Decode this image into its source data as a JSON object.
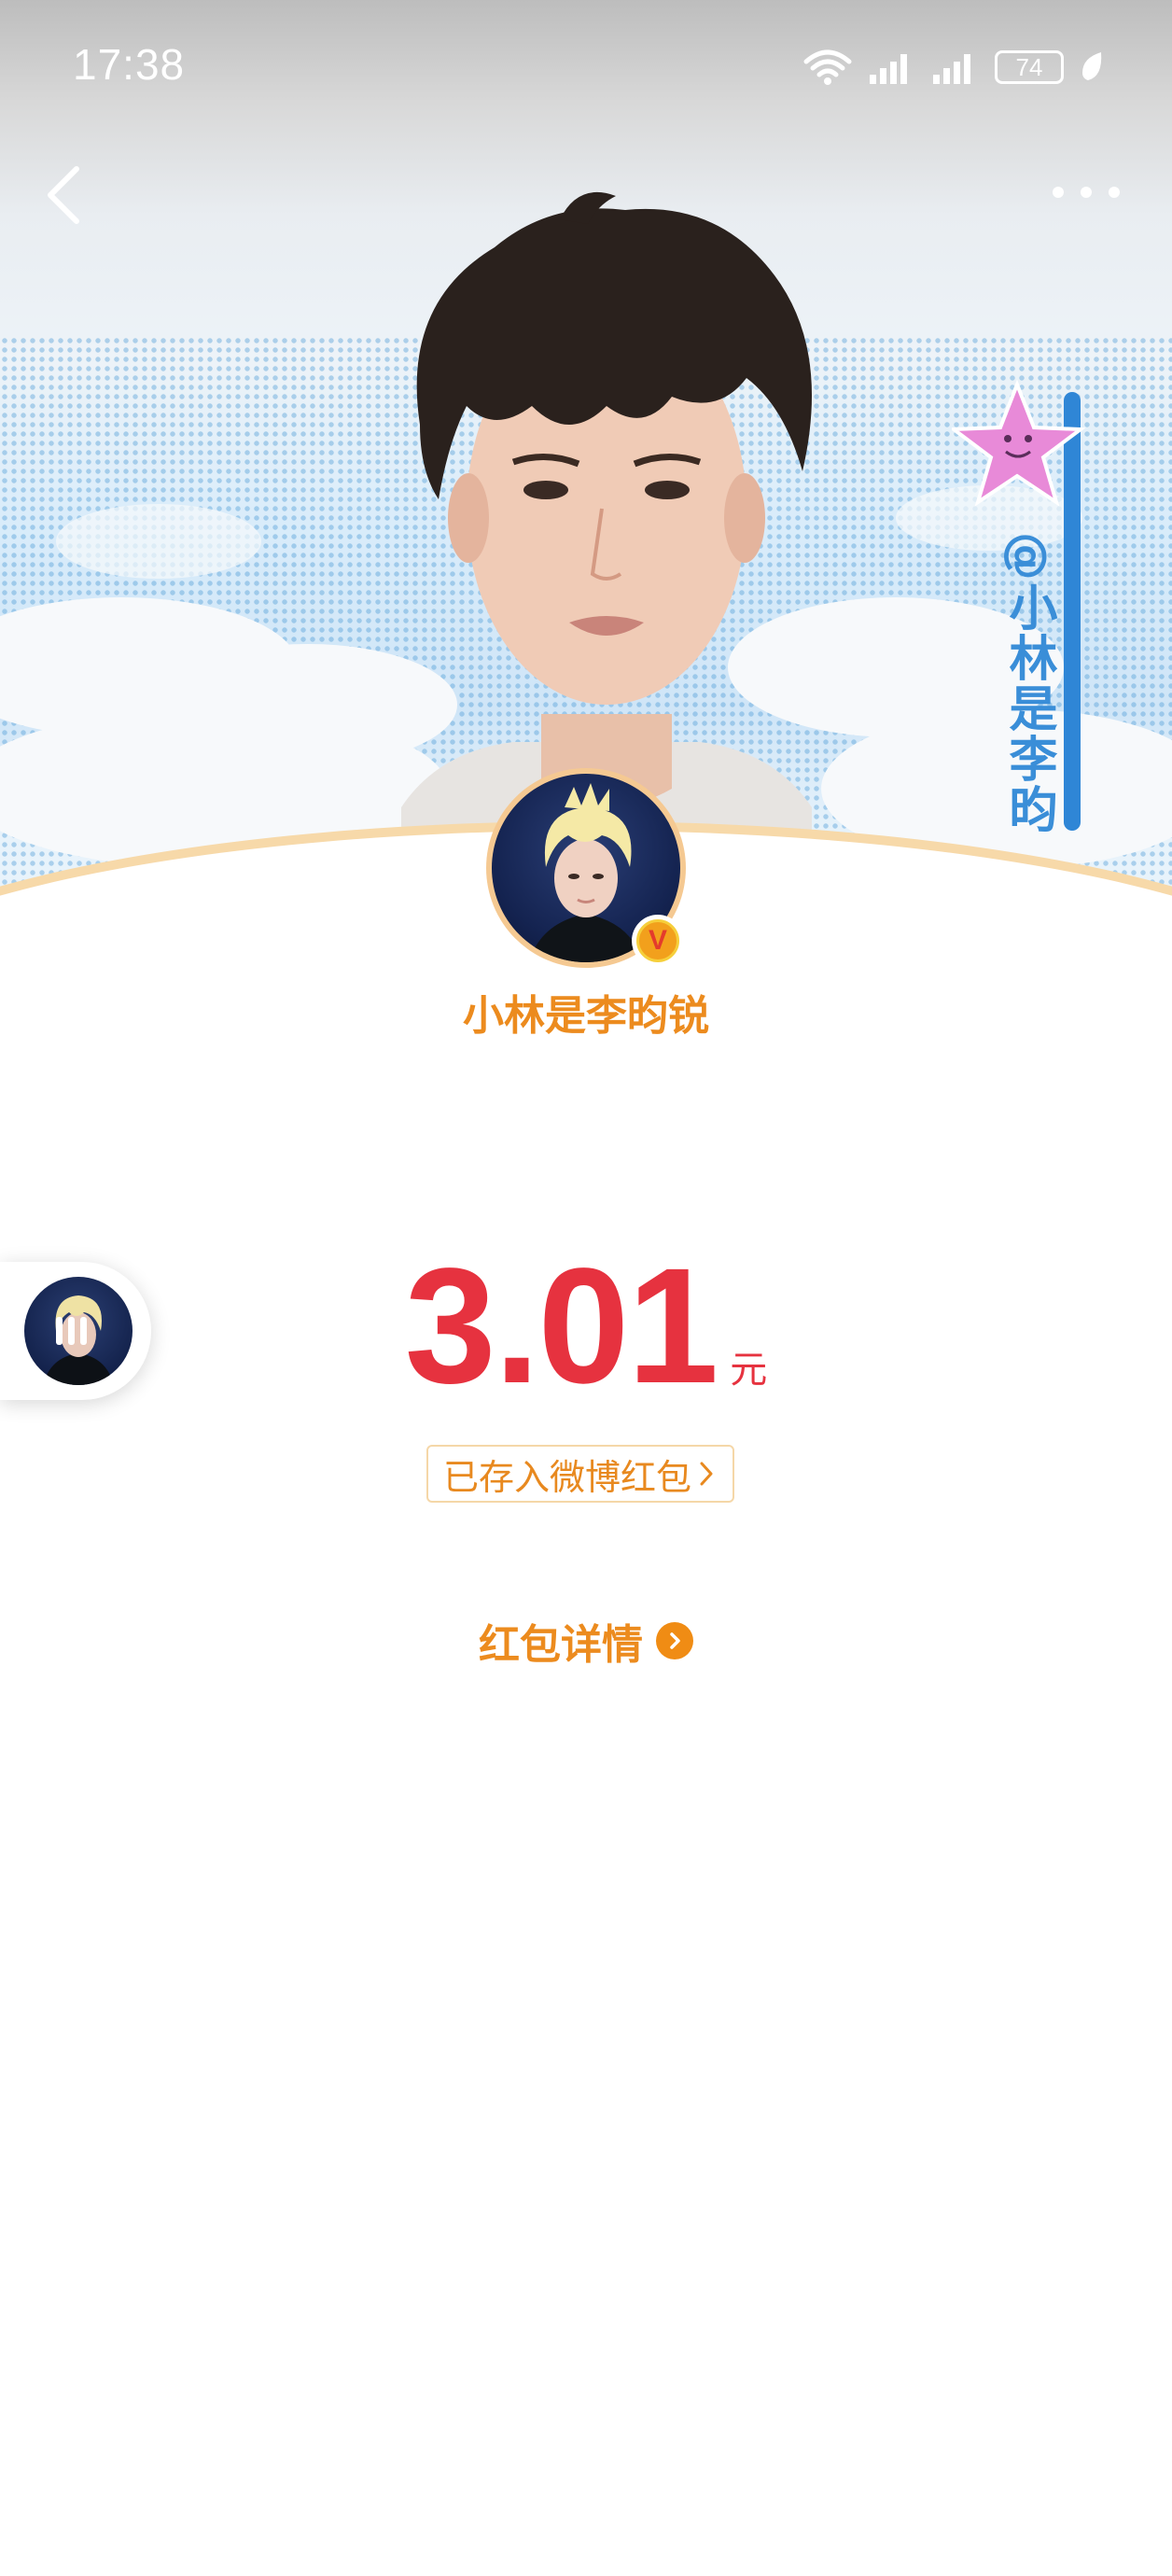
{
  "status_bar": {
    "time": "17:38",
    "battery": "74",
    "icons": [
      "wifi-icon",
      "signal-icon",
      "signal-icon",
      "battery-icon",
      "leaf-icon"
    ]
  },
  "nav": {
    "back_icon": "chevron-left-icon",
    "more_icon": "more-dots-icon"
  },
  "banner": {
    "sticker_text": "@小林是李昀"
  },
  "profile": {
    "name": "小林是李昀锐",
    "verified_icon": "verified-v-icon"
  },
  "red_packet": {
    "amount": "3.01",
    "unit": "元",
    "saved_label": "已存入微博红包",
    "detail_label": "红包详情"
  },
  "colors": {
    "amount_red": "#e6323f",
    "accent_orange": "#ec8b1e",
    "tag_border": "#f5d7a8"
  }
}
